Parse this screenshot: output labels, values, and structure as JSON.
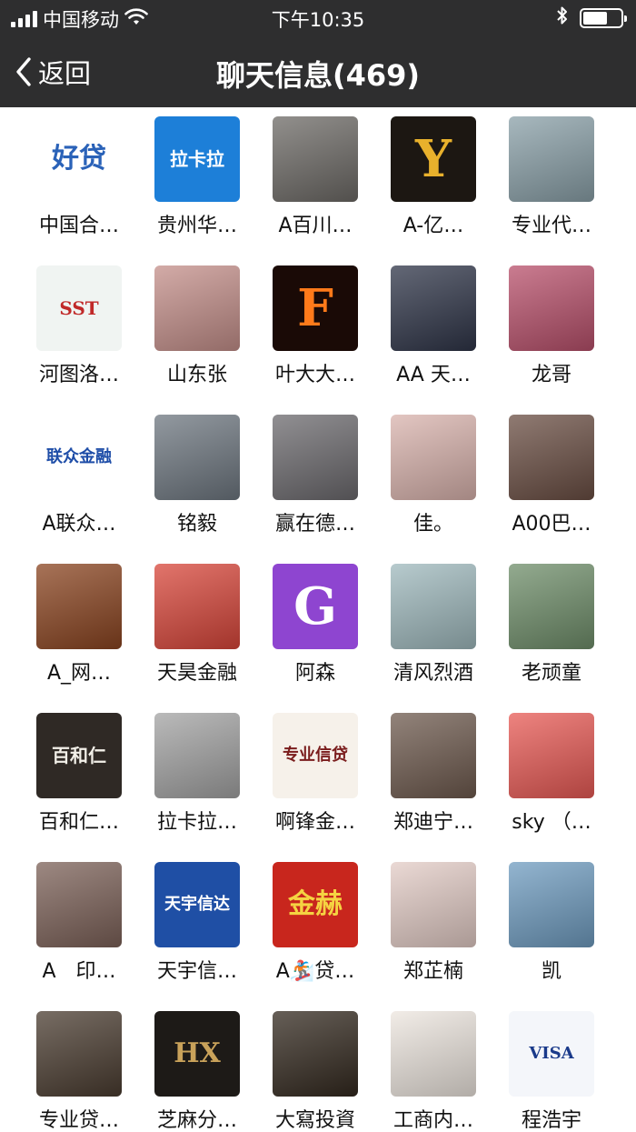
{
  "status_bar": {
    "carrier": "中国移动",
    "time": "下午10:35",
    "icons": [
      "signal-icon",
      "wifi-icon",
      "bluetooth-icon",
      "battery-icon"
    ],
    "battery_level": 0.65
  },
  "nav": {
    "back_label": "返回",
    "title": "聊天信息(469)",
    "back_icon": "chevron-left-icon"
  },
  "colors": {
    "header_bg": "#2e2e2f",
    "text": "#111111"
  },
  "members": [
    {
      "name": "中国合…",
      "avatar_text": "好贷",
      "bg": "#ffffff",
      "fg": "#2a62b8"
    },
    {
      "name": "贵州华…",
      "avatar_text": "拉卡拉",
      "bg": "#1d7fd8",
      "fg": "#ffffff"
    },
    {
      "name": "A百川…",
      "avatar_text": "",
      "bg": "#6d6a66",
      "fg": "#ffffff"
    },
    {
      "name": "A-亿…",
      "avatar_text": "Y",
      "bg": "#1c1712",
      "fg": "#e8b12c"
    },
    {
      "name": "专业代…",
      "avatar_text": "",
      "bg": "#8aa0a8",
      "fg": "#ffffff"
    },
    {
      "name": "河图洛…",
      "avatar_text": "SST",
      "bg": "#f0f4f2",
      "fg": "#c02828"
    },
    {
      "name": "山东张",
      "avatar_text": "",
      "bg": "#c48f8a",
      "fg": "#ffffff"
    },
    {
      "name": "叶大大…",
      "avatar_text": "F",
      "bg": "#1a0a06",
      "fg": "#ff7a1a"
    },
    {
      "name": "AA 天…",
      "avatar_text": "",
      "bg": "#2f3548",
      "fg": "#ffffff"
    },
    {
      "name": "龙哥",
      "avatar_text": "",
      "bg": "#b8506b",
      "fg": "#ffffff"
    },
    {
      "name": "A联众…",
      "avatar_text": "联众金融",
      "bg": "#ffffff",
      "fg": "#1f4ea8"
    },
    {
      "name": "铭毅",
      "avatar_text": "",
      "bg": "#6e7780",
      "fg": "#ffffff"
    },
    {
      "name": "赢在德…",
      "avatar_text": "",
      "bg": "#6c6a6e",
      "fg": "#ffffff"
    },
    {
      "name": "佳。",
      "avatar_text": "",
      "bg": "#d9b3ad",
      "fg": "#ffffff"
    },
    {
      "name": "A00巴…",
      "avatar_text": "",
      "bg": "#6a4e43",
      "fg": "#ffffff"
    },
    {
      "name": "A_网…",
      "avatar_text": "",
      "bg": "#8a4420",
      "fg": "#ffffff"
    },
    {
      "name": "天昊金融",
      "avatar_text": "",
      "bg": "#d8463a",
      "fg": "#ffffff"
    },
    {
      "name": "阿森",
      "avatar_text": "G",
      "bg": "#8e45d0",
      "fg": "#ffffff"
    },
    {
      "name": "清风烈酒",
      "avatar_text": "",
      "bg": "#9fb9bd",
      "fg": "#ffffff"
    },
    {
      "name": "老顽童",
      "avatar_text": "",
      "bg": "#6f8e6a",
      "fg": "#ffffff"
    },
    {
      "name": "百和仁…",
      "avatar_text": "百和仁",
      "bg": "#2f2925",
      "fg": "#f2efe8"
    },
    {
      "name": "拉卡拉…",
      "avatar_text": "",
      "bg": "#a3a3a3",
      "fg": "#ffffff"
    },
    {
      "name": "啊锋金…",
      "avatar_text": "专业信贷",
      "bg": "#f6f1ea",
      "fg": "#7a1c1c"
    },
    {
      "name": "郑迪宁…",
      "avatar_text": "",
      "bg": "#6e5a4e",
      "fg": "#ffffff"
    },
    {
      "name": "sky （…",
      "avatar_text": "",
      "bg": "#e85a55",
      "fg": "#ffffff"
    },
    {
      "name": "A　印…",
      "avatar_text": "",
      "bg": "#7c6158",
      "fg": "#ffffff"
    },
    {
      "name": "天宇信…",
      "avatar_text": "天宇信达",
      "bg": "#1f4fa5",
      "fg": "#ffffff"
    },
    {
      "name": "A🏂贷…",
      "avatar_text": "金赫",
      "bg": "#c8261d",
      "fg": "#f5d342"
    },
    {
      "name": "郑芷楠",
      "avatar_text": "",
      "bg": "#e3ccc6",
      "fg": "#ffffff"
    },
    {
      "name": "凯",
      "avatar_text": "",
      "bg": "#6f9cc0",
      "fg": "#ffffff"
    },
    {
      "name": "专业贷…",
      "avatar_text": "",
      "bg": "#4a3c30",
      "fg": "#ffffff"
    },
    {
      "name": "芝麻分…",
      "avatar_text": "HX",
      "bg": "#1d1a17",
      "fg": "#c9a25a"
    },
    {
      "name": "大寫投資",
      "avatar_text": "",
      "bg": "#33291f",
      "fg": "#ffffff"
    },
    {
      "name": "工商内…",
      "avatar_text": "",
      "bg": "#ede6df",
      "fg": "#8a4a2a"
    },
    {
      "name": "程浩宇",
      "avatar_text": "VISA",
      "bg": "#f4f6fa",
      "fg": "#1a3a8a"
    }
  ]
}
